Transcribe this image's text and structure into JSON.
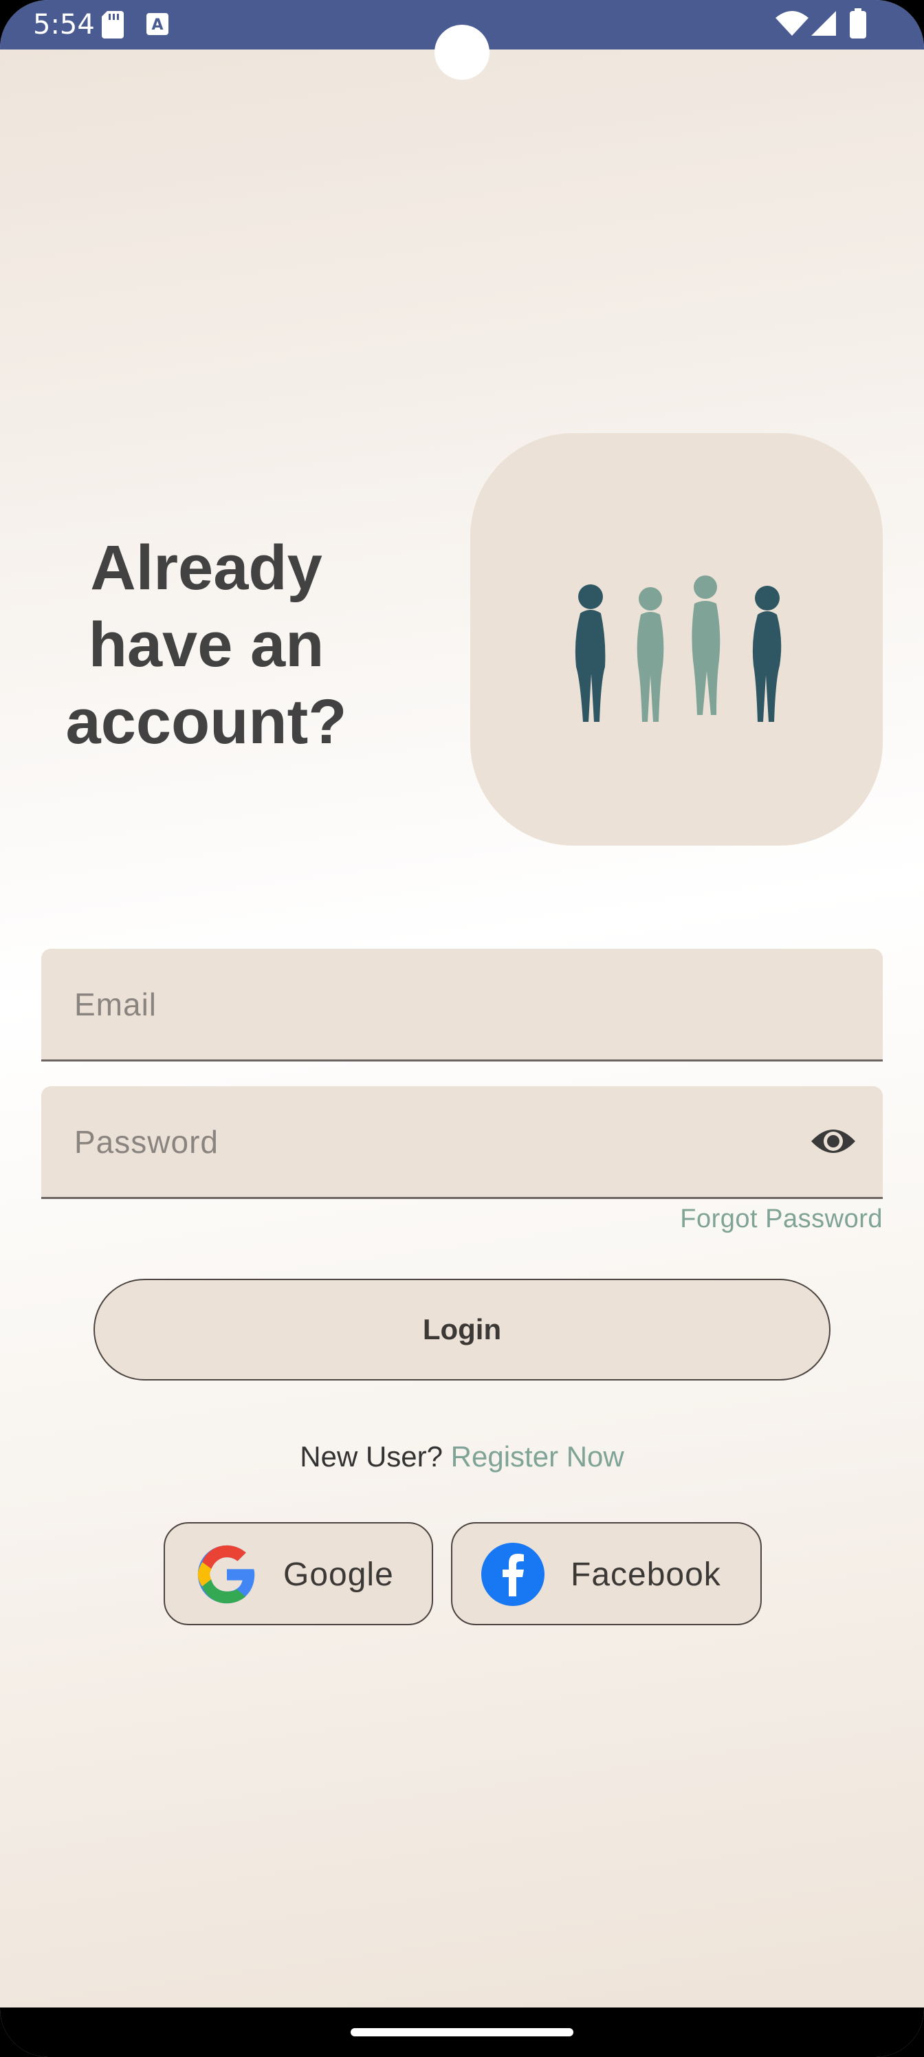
{
  "status_bar": {
    "time": "5:54",
    "icons": [
      "sd-card-icon",
      "autofill-a-icon",
      "wifi-icon",
      "signal-icon",
      "battery-icon"
    ],
    "color": "#4a5b92"
  },
  "header": {
    "title_line1": "Already",
    "title_line2": "have an",
    "title_line3": "account?",
    "illustration_icon": "people-group-icon"
  },
  "form": {
    "email_placeholder": "Email",
    "password_placeholder": "Password",
    "visibility_icon": "eye-icon",
    "forgot_label": "Forgot Password",
    "login_label": "Login"
  },
  "register": {
    "prompt": "New User?",
    "link_label": "Register Now"
  },
  "social": {
    "google_label": "Google",
    "facebook_label": "Facebook"
  },
  "colors": {
    "accent": "#7fa397",
    "field_bg": "#ebe1d6",
    "dark_figure": "#2f5763",
    "light_figure": "#7fa397",
    "facebook_blue": "#1877f2"
  }
}
